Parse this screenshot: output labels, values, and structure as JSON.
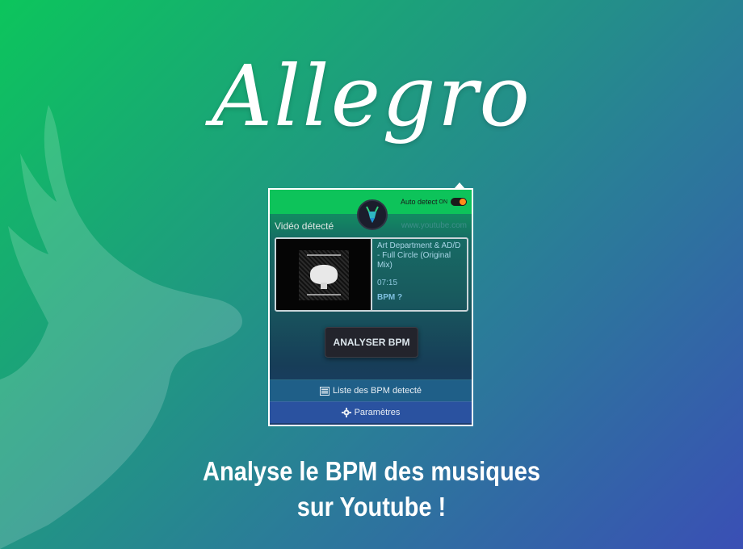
{
  "brand": {
    "title": "Allegro"
  },
  "popup": {
    "auto_detect_label": "Auto detect",
    "auto_detect_state": "ON",
    "video_label": "Vidéo détecté",
    "video_source": "www.youtube.com",
    "track": {
      "title": "Art Department & AD/D - Full Circle (Original Mix)",
      "duration": "07:15",
      "bpm": "BPM ?"
    },
    "analyze_label": "ANALYSER BPM",
    "list_label": "Liste des BPM detecté",
    "settings_label": "Paramètres"
  },
  "tagline": {
    "line1": "Analyse le BPM des musiques",
    "line2": "sur Youtube !"
  },
  "icons": {
    "deer": "deer-silhouette-icon",
    "logo": "deer-logo-icon",
    "list": "list-icon",
    "settings": "gear-icon"
  },
  "colors": {
    "gradient_start": "#0cc55c",
    "gradient_end": "#3a4fb5",
    "toggle_knob": "#ff8c1a",
    "popup_topband": "#0dc35a"
  }
}
